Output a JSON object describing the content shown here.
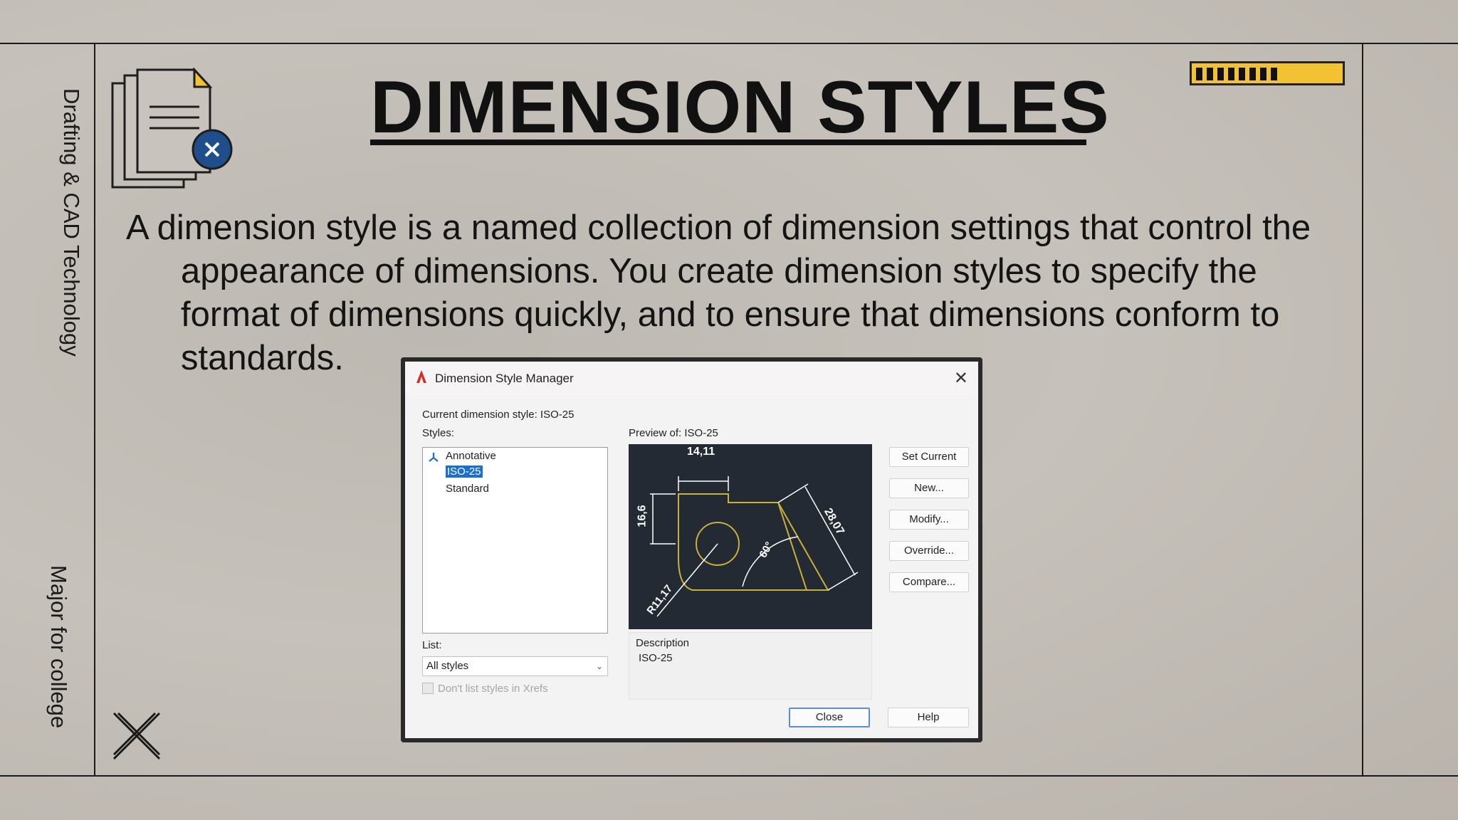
{
  "slide": {
    "title": "DIMENSION STYLES",
    "side_label_top": "Drafting & CAD Technology",
    "side_label_bottom": "Major for college",
    "body_text": "A dimension style is a named collection of dimension settings that control the appearance of dimensions. You create dimension styles to specify the format of dimensions quickly, and to ensure that dimensions conform to standards.",
    "progress_ticks": 8,
    "colors": {
      "accent": "#f2c232",
      "badge": "#1f4e8c",
      "doc_corner": "#f2c232"
    }
  },
  "dialog": {
    "title": "Dimension Style Manager",
    "current_style_label": "Current dimension style: ISO-25",
    "styles_label": "Styles:",
    "styles": [
      {
        "name": "Annotative",
        "icon": "annotative-icon",
        "selected": false
      },
      {
        "name": "ISO-25",
        "selected": true
      },
      {
        "name": "Standard",
        "selected": false
      }
    ],
    "preview_label": "Preview of: ISO-25",
    "preview_dims": {
      "width": "14,11",
      "height": "16,6",
      "slope": "28,07",
      "angle": "60°",
      "radius": "R11,17"
    },
    "description_label": "Description",
    "description_value": "ISO-25",
    "list_label": "List:",
    "list_value": "All styles",
    "xref_checkbox": "Don't list styles in Xrefs",
    "buttons": {
      "set_current": "Set Current",
      "new": "New...",
      "modify": "Modify...",
      "override": "Override...",
      "compare": "Compare...",
      "close": "Close",
      "help": "Help"
    }
  }
}
